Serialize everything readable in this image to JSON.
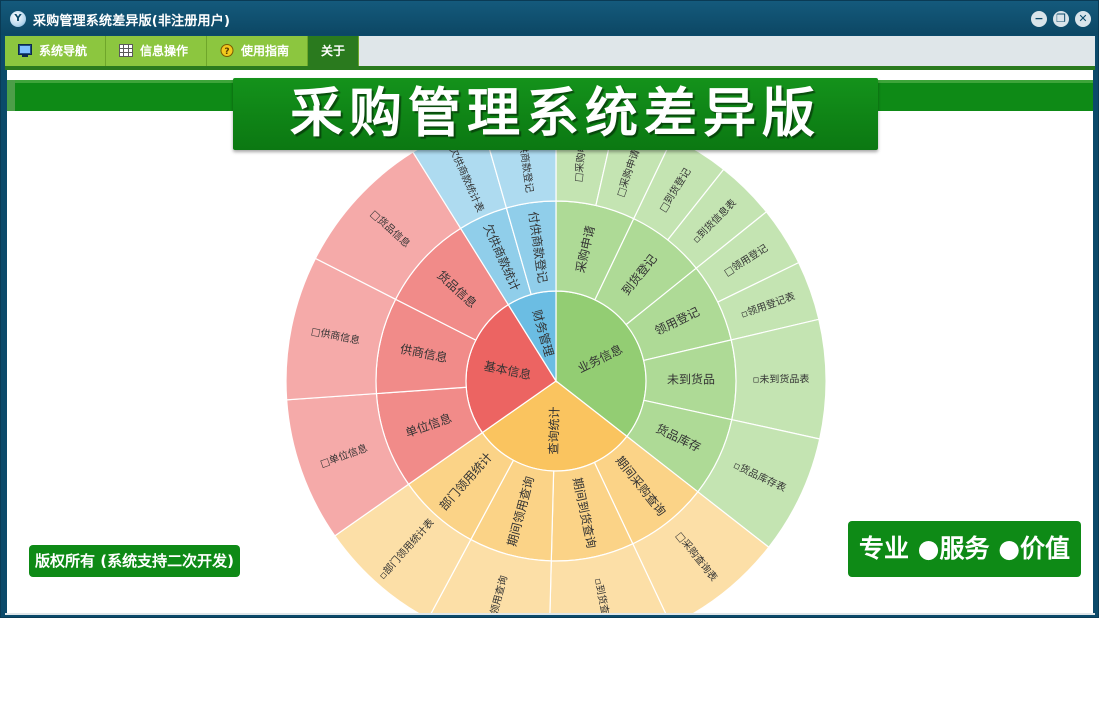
{
  "window": {
    "title": "采购管理系统差异版(非注册用户)",
    "app_icon_glyph": "Y",
    "controls": {
      "minimize": "−",
      "restore": "❐",
      "close": "✕"
    }
  },
  "menu": [
    {
      "label": "系统导航",
      "icon": "monitor-icon"
    },
    {
      "label": "信息操作",
      "icon": "grid-icon"
    },
    {
      "label": "使用指南",
      "icon": "help-icon"
    },
    {
      "label": "关于",
      "icon": ""
    }
  ],
  "banner": {
    "title": "采购管理系统差异版"
  },
  "sunburst": {
    "categories": [
      {
        "label": "业务信息",
        "color": "#93cd73",
        "children": [
          {
            "label": "采购申请",
            "leaves": [
              "□采购申请",
              "□采购申请表"
            ]
          },
          {
            "label": "到货登记",
            "leaves": [
              "□到货登记",
              "▫到货信息表"
            ]
          },
          {
            "label": "领用登记",
            "leaves": [
              "□领用登记",
              "▫领用登记表"
            ]
          },
          {
            "label": "未到货品",
            "leaves": [
              "▫未到货品表"
            ]
          },
          {
            "label": "货品库存",
            "leaves": [
              "▫货品库存表"
            ]
          }
        ]
      },
      {
        "label": "查询统计",
        "color": "#fac45f",
        "children": [
          {
            "label": "期间采购查询",
            "leaves": [
              "□采购查询表"
            ]
          },
          {
            "label": "期间到货查询",
            "leaves": [
              "▫到货查询"
            ]
          },
          {
            "label": "期间领用查询",
            "leaves": [
              "▫领用查询"
            ]
          },
          {
            "label": "部门领用统计",
            "leaves": [
              "▫部门领用统计表"
            ]
          }
        ]
      },
      {
        "label": "基本信息",
        "color": "#ec6462",
        "children": [
          {
            "label": "单位信息",
            "leaves": [
              "□单位信息"
            ]
          },
          {
            "label": "供商信息",
            "leaves": [
              "□供商信息"
            ]
          },
          {
            "label": "货品信息",
            "leaves": [
              "□货品信息"
            ]
          }
        ]
      },
      {
        "label": "财务管理",
        "color": "#6bbde3",
        "children": [
          {
            "label": "欠供商款统计",
            "leaves": [
              "□欠供商款统计表"
            ]
          },
          {
            "label": "付供商款登记",
            "leaves": [
              "□付供商款登记"
            ]
          }
        ]
      }
    ]
  },
  "footer": {
    "copyright": "版权所有 (系统支持二次开发)",
    "slogan": "专业 ●服务 ●价值"
  }
}
